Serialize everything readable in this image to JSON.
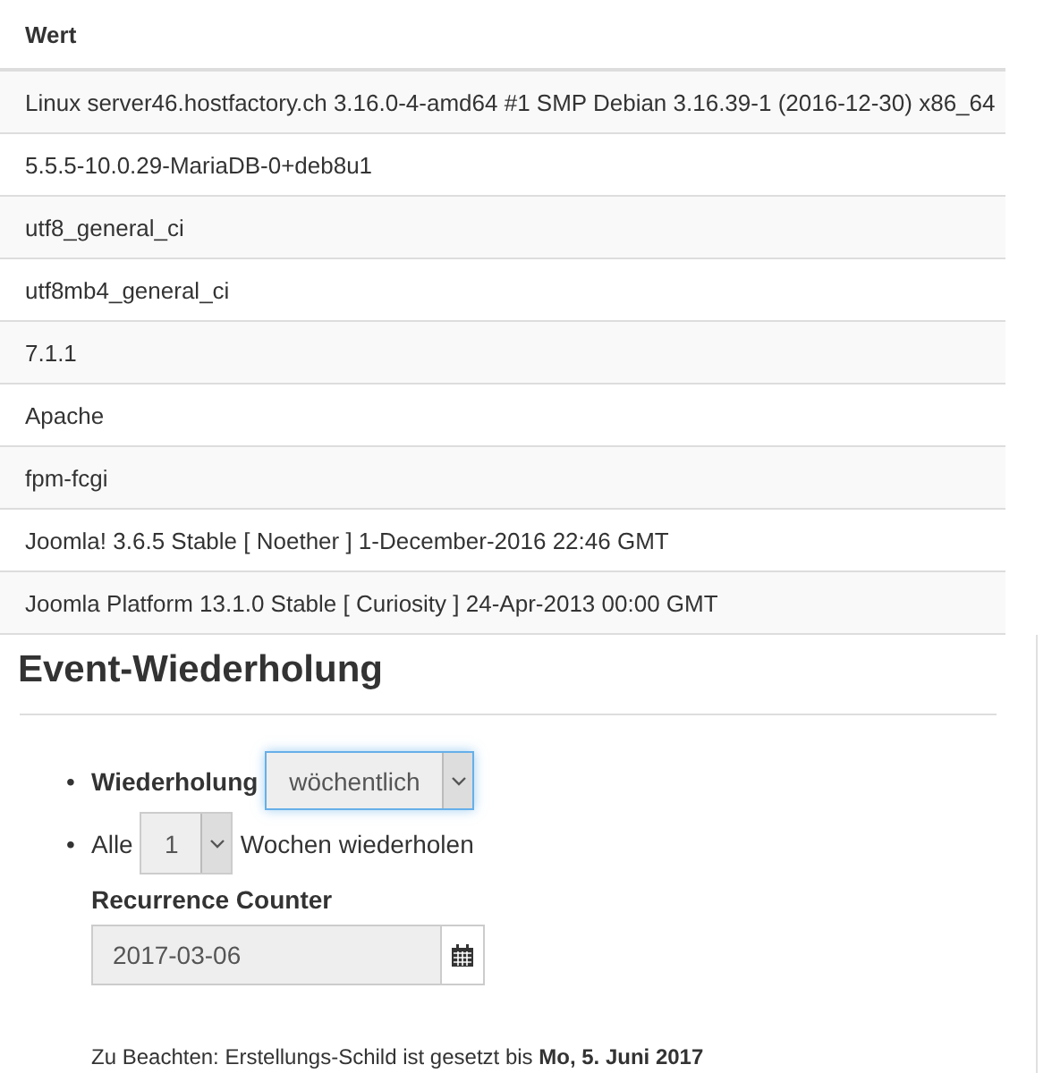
{
  "table": {
    "header": "Wert",
    "rows": [
      "Linux server46.hostfactory.ch 3.16.0-4-amd64 #1 SMP Debian 3.16.39-1 (2016-12-30) x86_64",
      "5.5.5-10.0.29-MariaDB-0+deb8u1",
      "utf8_general_ci",
      "utf8mb4_general_ci",
      "7.1.1",
      "Apache",
      "fpm-fcgi",
      "Joomla! 3.6.5 Stable [ Noether ] 1-December-2016 22:46 GMT",
      "Joomla Platform 13.1.0 Stable [ Curiosity ] 24-Apr-2013 00:00 GMT"
    ]
  },
  "section": {
    "title": "Event-Wiederholung",
    "repeat": {
      "bullet": "•",
      "label": "Wiederholung",
      "value": "wöchentlich",
      "focused": true
    },
    "every": {
      "bullet": "•",
      "prefix": "Alle",
      "value": "1",
      "suffix": "Wochen wiederholen"
    },
    "counter": {
      "label": "Recurrence Counter",
      "value": "2017-03-06"
    },
    "note": "Zu Beachten: Erstellungs-Schild ist gesetzt bis **Mo, 5. Juni 2017**"
  }
}
